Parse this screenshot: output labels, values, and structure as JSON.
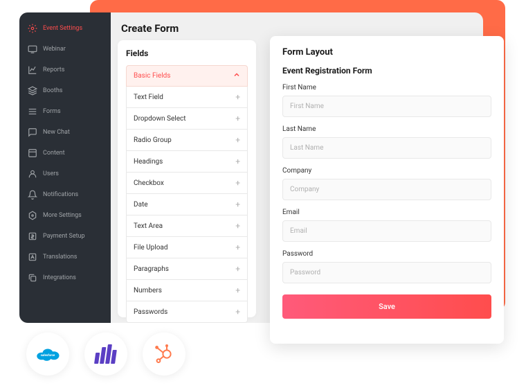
{
  "sidebar": {
    "items": [
      {
        "label": "Event Settings",
        "icon": "gear-icon",
        "active": true
      },
      {
        "label": "Webinar",
        "icon": "monitor-icon"
      },
      {
        "label": "Reports",
        "icon": "chart-icon"
      },
      {
        "label": "Booths",
        "icon": "cube-icon"
      },
      {
        "label": "Forms",
        "icon": "forms-icon"
      },
      {
        "label": "New Chat",
        "icon": "chat-icon"
      },
      {
        "label": "Content",
        "icon": "content-icon"
      },
      {
        "label": "Users",
        "icon": "user-icon"
      },
      {
        "label": "Notifications",
        "icon": "bell-icon"
      },
      {
        "label": "More Settings",
        "icon": "hex-icon"
      },
      {
        "label": "Payment Setup",
        "icon": "dollar-icon"
      },
      {
        "label": "Translations",
        "icon": "translate-icon"
      },
      {
        "label": "Integrations",
        "icon": "stack-icon"
      }
    ]
  },
  "page": {
    "title": "Create Form"
  },
  "fields_panel": {
    "header": "Fields",
    "group_label": "Basic Fields",
    "items": [
      "Text Field",
      "Dropdown Select",
      "Radio Group",
      "Headings",
      "Checkbox",
      "Date",
      "Text Area",
      "File Upload",
      "Paragraphs",
      "Numbers",
      "Passwords"
    ]
  },
  "layout_panel": {
    "header": "Form Layout",
    "form_title": "Event Registration Form",
    "fields": [
      {
        "label": "First Name",
        "placeholder": "First Name"
      },
      {
        "label": "Last Name",
        "placeholder": "Last Name"
      },
      {
        "label": "Company",
        "placeholder": "Company"
      },
      {
        "label": "Email",
        "placeholder": "Email"
      },
      {
        "label": "Password",
        "placeholder": "Password"
      }
    ],
    "save_label": "Save"
  },
  "logos": [
    "salesforce",
    "purple-bars",
    "hubspot"
  ]
}
